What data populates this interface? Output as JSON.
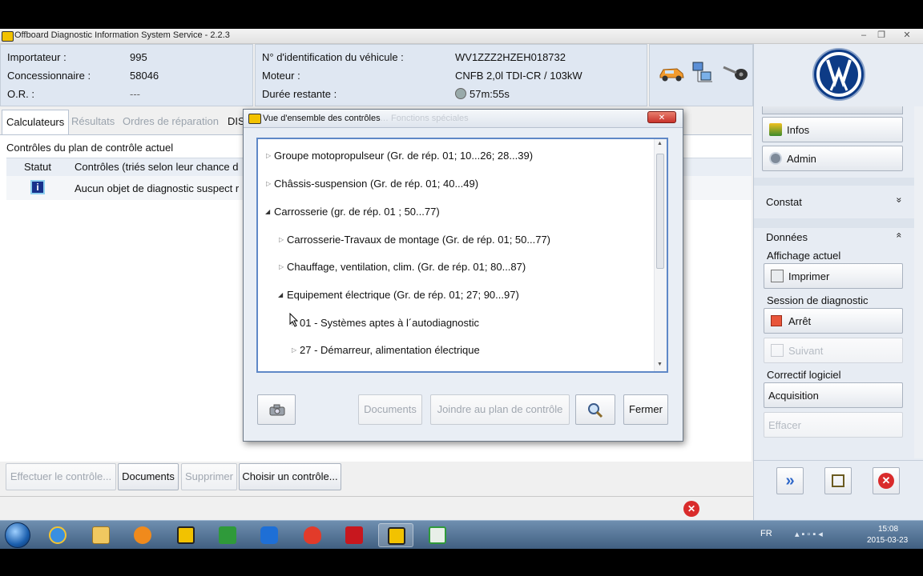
{
  "window": {
    "title": "Offboard Diagnostic Information System Service - 2.2.3",
    "minimize_glyph": "–",
    "maximize_glyph": "❐",
    "close_glyph": "✕"
  },
  "vehicle_info": {
    "importer_label": "Importateur :",
    "importer_value": "995",
    "dealer_label": "Concessionnaire :",
    "dealer_value": "58046",
    "or_label": "O.R. :",
    "or_value": "---",
    "vin_label": "N° d'identification du véhicule :",
    "vin_value": "WV1ZZZ2HZEH018732",
    "engine_label": "Moteur :",
    "engine_value": "CNFB 2,0l TDI-CR / 103kW",
    "remaining_label": "Durée restante :",
    "remaining_value": "57m:55s"
  },
  "header_icons": [
    "car-icon",
    "network-icon",
    "key-icon"
  ],
  "tabs": [
    {
      "label": "Calculateurs",
      "state": "active"
    },
    {
      "label": "Résultats",
      "state": "disabled"
    },
    {
      "label": "Ordres de réparation",
      "state": "disabled"
    },
    {
      "label": "DIS",
      "state": "normal"
    }
  ],
  "test_plan": {
    "heading": "Contrôles du plan de contrôle actuel",
    "col_status": "Statut",
    "col_tests": "Contrôles (triés selon leur chance d",
    "row_text": "Aucun objet de diagnostic suspect r"
  },
  "bottom_buttons": {
    "perform": "Effectuer le contrôle...",
    "documents": "Documents",
    "delete": "Supprimer",
    "choose": "Choisir un contrôle..."
  },
  "sidebar": {
    "infos": "Infos",
    "admin": "Admin",
    "constat": "Constat",
    "donnees": "Données",
    "affichage": "Affichage actuel",
    "imprimer": "Imprimer",
    "session": "Session de diagnostic",
    "arret": "Arrêt",
    "suivant": "Suivant",
    "correctif": "Correctif logiciel",
    "acquisition": "Acquisition",
    "effacer": "Effacer",
    "expand_glyph": "»",
    "collapse_glyph": "«"
  },
  "dialog": {
    "title": "Vue d'ensemble des contrôles",
    "title_ghost": "… Fonctions spéciales",
    "close_glyph": "✕",
    "tree": [
      {
        "label": "Groupe motopropulseur (Gr. de rép. 01; 10...26; 28...39)",
        "level": 0,
        "expanded": false
      },
      {
        "label": "Châssis-suspension (Gr. de rép. 01; 40...49)",
        "level": 0,
        "expanded": false
      },
      {
        "label": "Carrosserie (gr. de rép. 01 ; 50...77)",
        "level": 0,
        "expanded": true
      },
      {
        "label": "Carrosserie-Travaux de montage (Gr. de rép. 01; 50...77)",
        "level": 1,
        "expanded": false
      },
      {
        "label": "Chauffage, ventilation, clim. (Gr. de rép. 01; 80...87)",
        "level": 1,
        "expanded": false
      },
      {
        "label": "Equipement électrique (Gr. de rép. 01; 27; 90...97)",
        "level": 1,
        "expanded": true
      },
      {
        "label": "01 - Systèmes aptes à l´autodiagnostic",
        "level": 2,
        "expanded": false
      },
      {
        "label": "27 - Démarreur, alimentation électrique",
        "level": 2,
        "expanded": false
      }
    ],
    "btn_documents": "Documents",
    "btn_join": "Joindre au plan de contrôle",
    "btn_close": "Fermer"
  },
  "taskbar": {
    "language": "FR",
    "time": "15:08",
    "date": "2015-03-23",
    "apps": [
      "start-orb-icon",
      "internet-explorer-icon",
      "file-explorer-icon",
      "media-player-icon",
      "odis-icon",
      "camtasia-icon",
      "teamviewer-icon",
      "flame-app-icon",
      "acrobat-icon",
      "odis-active-icon",
      "camtasia-recorder-icon"
    ]
  },
  "colors": {
    "accent": "#5f88c7",
    "panel": "#dfe7f2",
    "close_red": "#d92b2b",
    "vw_blue": "#0d3b86"
  }
}
